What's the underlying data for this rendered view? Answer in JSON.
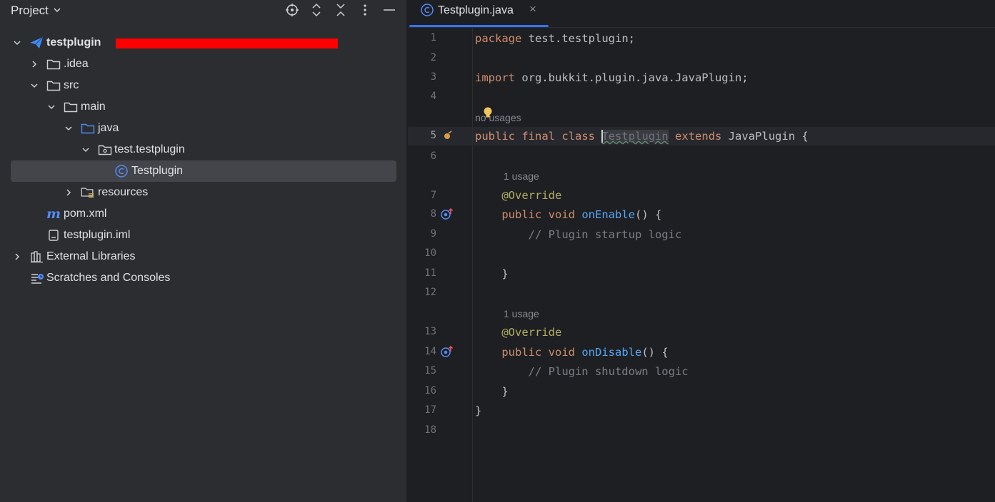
{
  "project_panel": {
    "title": "Project",
    "tools": [
      "locate-icon",
      "expand-all-icon",
      "collapse-all-icon",
      "more-options-icon",
      "minimize-icon"
    ],
    "tree": [
      {
        "label": "testplugin",
        "depth": 0,
        "expanded": true,
        "icon": "project-icon"
      },
      {
        "label": ".idea",
        "depth": 1,
        "expanded": false,
        "icon": "folder-icon"
      },
      {
        "label": "src",
        "depth": 1,
        "expanded": true,
        "icon": "folder-icon"
      },
      {
        "label": "main",
        "depth": 2,
        "expanded": true,
        "icon": "folder-icon"
      },
      {
        "label": "java",
        "depth": 3,
        "expanded": true,
        "icon": "source-folder-icon"
      },
      {
        "label": "test.testplugin",
        "depth": 4,
        "expanded": true,
        "icon": "package-icon"
      },
      {
        "label": "Testplugin",
        "depth": 5,
        "icon": "class-icon",
        "selected": true
      },
      {
        "label": "resources",
        "depth": 3,
        "expanded": false,
        "icon": "resources-folder-icon"
      },
      {
        "label": "pom.xml",
        "depth": 1,
        "icon": "maven-icon"
      },
      {
        "label": "testplugin.iml",
        "depth": 1,
        "icon": "iml-file-icon"
      },
      {
        "label": "External Libraries",
        "depth": 0,
        "expanded": false,
        "icon": "libraries-icon"
      },
      {
        "label": "Scratches and Consoles",
        "depth": 0,
        "icon": "scratches-icon"
      }
    ]
  },
  "editor": {
    "tab": {
      "label": "Testplugin.java",
      "close": "×"
    },
    "hints": {
      "no_usages": "no usages",
      "one_usage": "1 usage"
    },
    "lines": [
      {
        "n": "1",
        "code": "package test.testplugin;"
      },
      {
        "n": "2",
        "code": ""
      },
      {
        "n": "3",
        "code": "import org.bukkit.plugin.java.JavaPlugin;"
      },
      {
        "n": "4",
        "code": ""
      },
      {
        "n": "5",
        "code": "public final class Testplugin extends JavaPlugin {"
      },
      {
        "n": "6",
        "code": ""
      },
      {
        "n": "7",
        "code": "@Override"
      },
      {
        "n": "8",
        "code": "public void onEnable() {"
      },
      {
        "n": "9",
        "code": "// Plugin startup logic"
      },
      {
        "n": "10",
        "code": ""
      },
      {
        "n": "11",
        "code": "}"
      },
      {
        "n": "12",
        "code": ""
      },
      {
        "n": "13",
        "code": "@Override"
      },
      {
        "n": "14",
        "code": "public void onDisable() {"
      },
      {
        "n": "15",
        "code": "// Plugin shutdown logic"
      },
      {
        "n": "16",
        "code": "}"
      },
      {
        "n": "17",
        "code": "}"
      },
      {
        "n": "18",
        "code": ""
      }
    ],
    "tokens": {
      "package": "package",
      "pkg": "test.testplugin;",
      "import": "import",
      "imp": "org.bukkit.plugin.java.JavaPlugin;",
      "public": "public",
      "final": "final",
      "class": "class",
      "classname": "Testplugin",
      "extends": "extends",
      "superclass": "JavaPlugin",
      "lbrace": "{",
      "override": "@Override",
      "void": "void",
      "onEnable": "onEnable",
      "onDisable": "onDisable",
      "parens": "() {",
      "comment_startup": "// Plugin startup logic",
      "comment_shutdown": "// Plugin shutdown logic",
      "rbrace": "}"
    }
  }
}
